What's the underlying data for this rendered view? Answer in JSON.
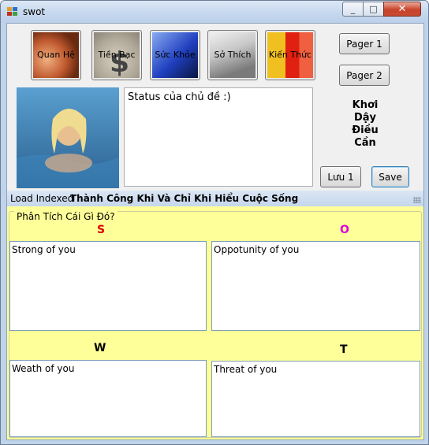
{
  "window": {
    "title": "swot",
    "minimize": "_",
    "maximize": "□",
    "close": "✕"
  },
  "categories": [
    {
      "label": "Quan Hệ",
      "icon": "face-photo-icon"
    },
    {
      "label": "Tiền Bạc",
      "icon": "money-bag-icon"
    },
    {
      "label": "Sức Khỏe",
      "icon": "health-icon"
    },
    {
      "label": "Sở Thích",
      "icon": "hobby-photo-icon"
    },
    {
      "label": "Kiến Thức",
      "icon": "knowledge-icon"
    }
  ],
  "buttons": {
    "pager1": "Pager 1",
    "pager2": "Pager 2",
    "luu1": "Lưu 1",
    "save": "Save"
  },
  "status_text": "Status của chủ đề :)",
  "motto": [
    "Khơi",
    "Dậy",
    "Điều",
    "Cần"
  ],
  "load": {
    "label": "Load Indexed",
    "value": "Thành Công Khi Và Chỉ Khi Hiểu Cuộc Sống"
  },
  "group_title": "Phân Tích Cái Gì Đó?",
  "swot": {
    "s_label": "S",
    "o_label": "O",
    "w_label": "W",
    "t_label": "T",
    "s_text": "Strong of you",
    "o_text": "Oppotunity of you",
    "w_text": "Weath of you",
    "t_text": "Threat of you"
  },
  "colors": {
    "s": "#dd0000",
    "o": "#dd00dd",
    "w": "#000000",
    "t": "#000000",
    "panel": "#ffff99"
  }
}
